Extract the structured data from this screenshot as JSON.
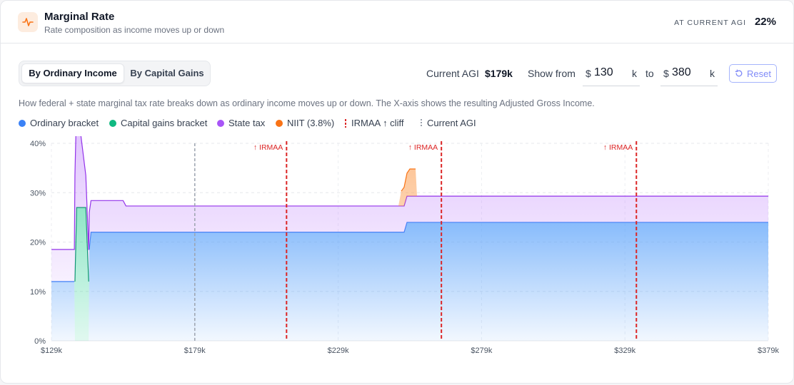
{
  "header": {
    "title": "Marginal Rate",
    "subtitle": "Rate composition as income moves up or down",
    "agi_label": "AT CURRENT AGI",
    "agi_value": "22%"
  },
  "tabs": [
    {
      "label": "By Ordinary Income",
      "active": true
    },
    {
      "label": "By Capital Gains",
      "active": false
    }
  ],
  "controls": {
    "current_agi_label": "Current AGI",
    "current_agi_value": "$179k",
    "show_from_label": "Show from",
    "currency": "$",
    "from_value": "130",
    "from_unit": "k",
    "to_label": "to",
    "to_value": "380",
    "to_unit": "k",
    "reset_label": "Reset"
  },
  "description": "How federal + state marginal tax rate breaks down as ordinary income moves up or down. The X-axis shows the resulting Adjusted Gross Income.",
  "legend": [
    {
      "label": "Ordinary bracket",
      "color": "#3b82f6",
      "kind": "dot"
    },
    {
      "label": "Capital gains bracket",
      "color": "#10b981",
      "kind": "dot"
    },
    {
      "label": "State tax",
      "color": "#a855f7",
      "kind": "dot"
    },
    {
      "label": "NIIT (3.8%)",
      "color": "#f97316",
      "kind": "dot"
    },
    {
      "label": "IRMAA ↑ cliff",
      "color": "#dc2626",
      "kind": "dash"
    },
    {
      "label": "Current AGI",
      "color": "#9ca3af",
      "kind": "dots"
    }
  ],
  "chart_data": {
    "type": "area",
    "stacked": true,
    "x_unit": "k",
    "xlim": [
      129,
      379
    ],
    "ylim": [
      0,
      40
    ],
    "x_ticks": [
      129,
      179,
      229,
      279,
      329,
      379
    ],
    "x_tick_labels": [
      "$129k",
      "$179k",
      "$229k",
      "$279k",
      "$329k",
      "$379k"
    ],
    "y_ticks": [
      0,
      10,
      20,
      30,
      40
    ],
    "y_tick_labels": [
      "0%",
      "10%",
      "20%",
      "30%",
      "40%"
    ],
    "grid": true,
    "series": [
      {
        "name": "Ordinary bracket",
        "color": "#3b82f6",
        "points": [
          [
            129,
            12
          ],
          [
            137,
            12
          ],
          [
            137.2,
            0
          ],
          [
            142,
            0
          ],
          [
            142.2,
            18.5
          ],
          [
            142.8,
            22
          ],
          [
            252,
            22
          ],
          [
            253,
            24
          ],
          [
            379,
            24
          ]
        ]
      },
      {
        "name": "Capital gains bracket",
        "color": "#10b981",
        "points": [
          [
            129,
            0
          ],
          [
            137,
            0
          ],
          [
            137.2,
            12
          ],
          [
            137.8,
            27
          ],
          [
            141,
            27
          ],
          [
            142,
            12
          ],
          [
            142.2,
            0
          ],
          [
            379,
            0
          ]
        ]
      },
      {
        "name": "State tax",
        "color": "#a855f7",
        "points": [
          [
            129,
            6.5
          ],
          [
            137,
            6.5
          ],
          [
            137.2,
            21.5
          ],
          [
            137.8,
            21.5
          ],
          [
            141,
            6.5
          ],
          [
            142,
            6.4
          ],
          [
            142.2,
            7.5
          ],
          [
            142.8,
            6.4
          ],
          [
            154,
            6.4
          ],
          [
            155,
            5.3
          ],
          [
            252,
            5.3
          ],
          [
            253,
            5.3
          ],
          [
            379,
            5.3
          ]
        ]
      },
      {
        "name": "NIIT (3.8%)",
        "color": "#f97316",
        "points": [
          [
            129,
            0
          ],
          [
            250,
            0
          ],
          [
            251,
            3
          ],
          [
            252,
            3.8
          ],
          [
            254,
            5.5
          ],
          [
            256,
            5.5
          ],
          [
            256.5,
            0
          ],
          [
            379,
            0
          ]
        ]
      }
    ],
    "current_agi": 179,
    "irmaa_cliffs": [
      {
        "x": 211,
        "label": "↑ IRMAA"
      },
      {
        "x": 265,
        "label": "↑ IRMAA"
      },
      {
        "x": 333,
        "label": "↑ IRMAA"
      }
    ]
  }
}
